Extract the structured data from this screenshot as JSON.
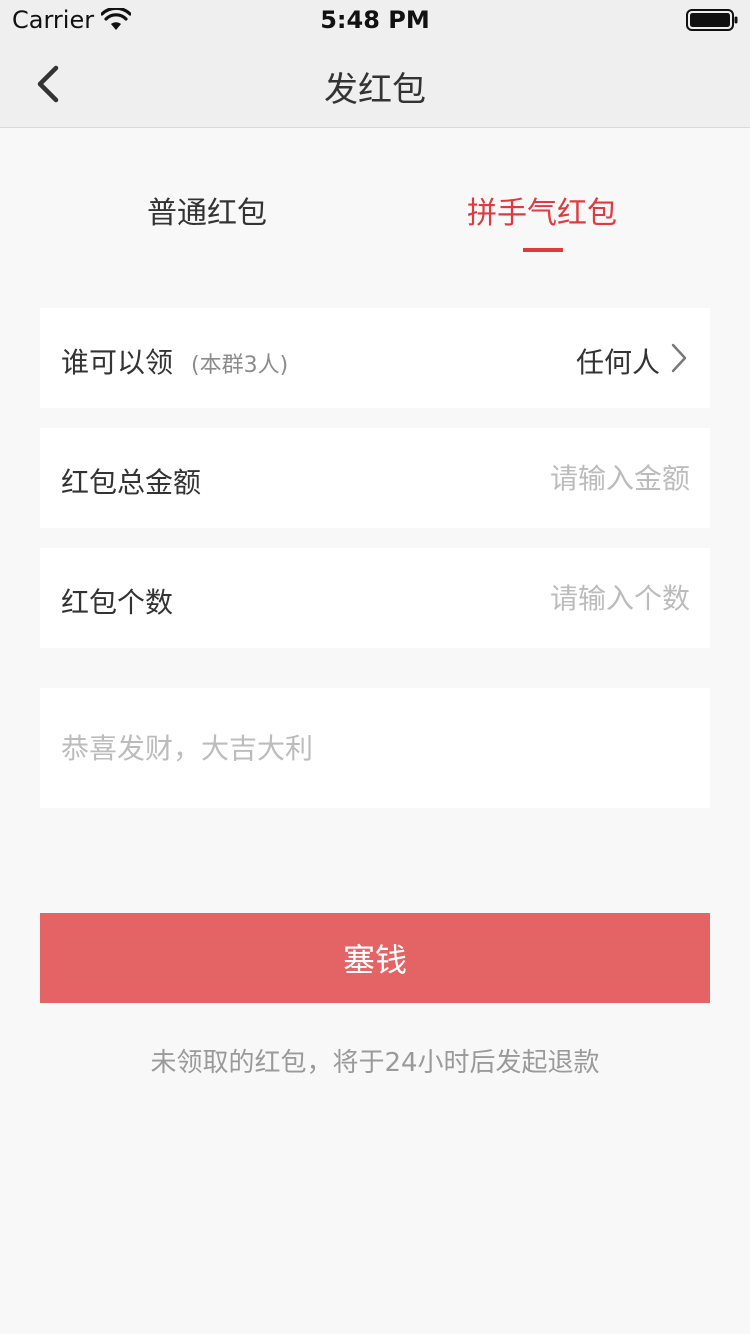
{
  "status_bar": {
    "carrier": "Carrier",
    "time": "5:48 PM"
  },
  "nav": {
    "title": "发红包",
    "back_icon": "chevron-left-icon"
  },
  "tabs": {
    "normal": "普通红包",
    "lucky": "拼手气红包",
    "active": "lucky",
    "accent_color": "#e0393e"
  },
  "form": {
    "who": {
      "label": "谁可以领",
      "sub": "(本群3人)",
      "value": "任何人",
      "icon": "chevron-right-icon"
    },
    "amount": {
      "label": "红包总金额",
      "placeholder": "请输入金额",
      "value": ""
    },
    "count": {
      "label": "红包个数",
      "placeholder": "请输入个数",
      "value": ""
    },
    "greeting": {
      "placeholder": "恭喜发财，大吉大利",
      "value": ""
    }
  },
  "submit": {
    "label": "塞钱",
    "color": "#e46364"
  },
  "footnote": "未领取的红包，将于24小时后发起退款"
}
